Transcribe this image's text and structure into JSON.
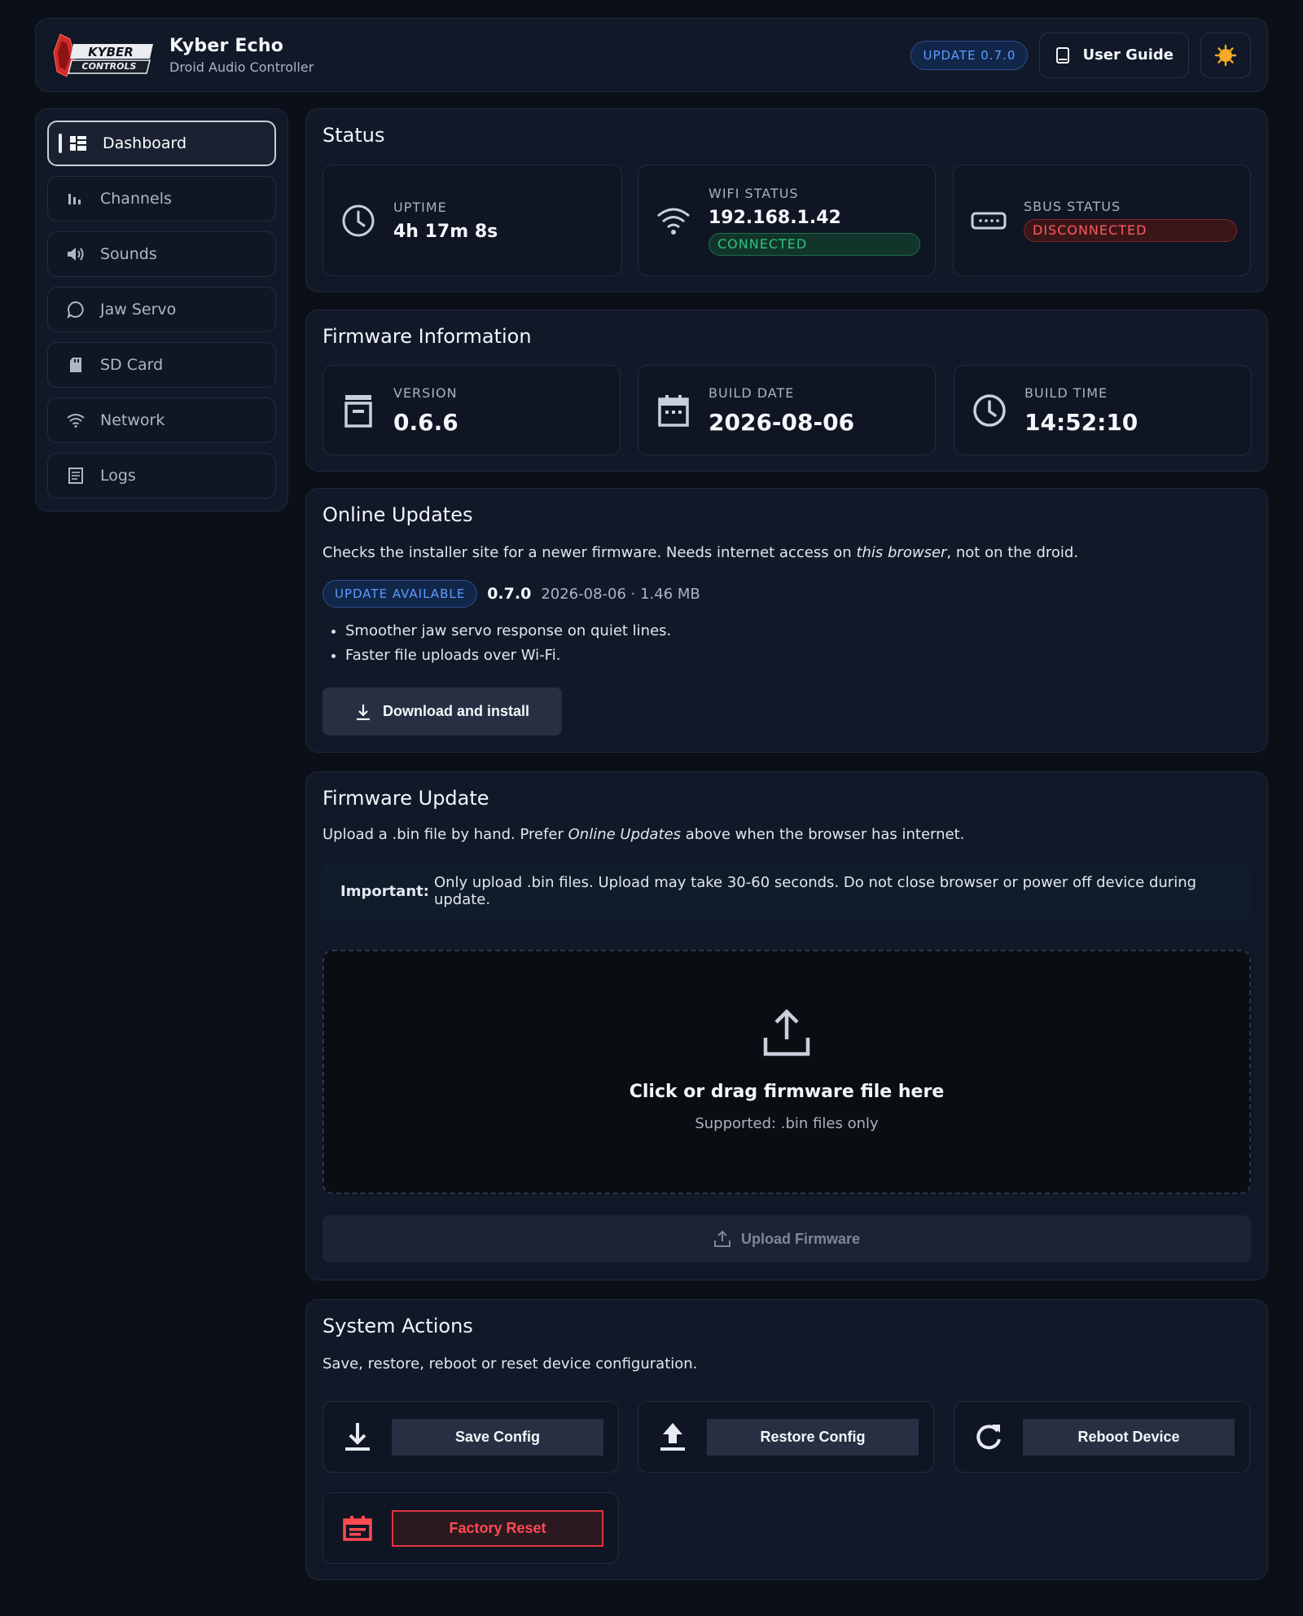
{
  "header": {
    "logo_text": "KYBER CONTROLS",
    "title": "Kyber Echo",
    "subtitle": "Droid Audio Controller",
    "update_badge": "UPDATE 0.7.0",
    "guide_label": "User Guide",
    "theme_icon": "sun-icon"
  },
  "sidebar": {
    "items": [
      {
        "label": "Dashboard",
        "icon": "dashboard-icon",
        "active": true
      },
      {
        "label": "Channels",
        "icon": "bars-icon"
      },
      {
        "label": "Sounds",
        "icon": "speaker-icon"
      },
      {
        "label": "Jaw Servo",
        "icon": "chat-bubble-icon"
      },
      {
        "label": "SD Card",
        "icon": "sd-card-icon"
      },
      {
        "label": "Network",
        "icon": "wifi-icon"
      },
      {
        "label": "Logs",
        "icon": "document-icon"
      }
    ]
  },
  "status": {
    "title": "Status",
    "uptime_label": "UPTIME",
    "uptime_value": "4h 17m 8s",
    "wifi_label": "WIFI STATUS",
    "wifi_value": "192.168.1.42",
    "wifi_state": "CONNECTED",
    "sbus_label": "SBUS STATUS",
    "sbus_state": "DISCONNECTED"
  },
  "firmware_info": {
    "title": "Firmware Information",
    "version_label": "VERSION",
    "version_value": "0.6.6",
    "date_label": "BUILD DATE",
    "date_value": "2026-08-06",
    "time_label": "BUILD TIME",
    "time_value": "14:52:10"
  },
  "online_updates": {
    "title": "Online Updates",
    "desc_before": "Checks the installer site for a newer firmware. Needs internet access on ",
    "desc_em": "this browser",
    "desc_after": ", not on the droid.",
    "badge": "UPDATE AVAILABLE",
    "version": "0.7.0",
    "meta": "2026-08-06 · 1.46 MB",
    "notes": [
      "Smoother jaw servo response on quiet lines.",
      "Faster file uploads over Wi-Fi."
    ],
    "button": "Download and install"
  },
  "firmware_update": {
    "title": "Firmware Update",
    "desc_before": "Upload a .bin file by hand. Prefer ",
    "desc_em": "Online Updates",
    "desc_after": " above when the browser has internet.",
    "important_label": "Important:",
    "important_text": "Only upload .bin files. Upload may take 30-60 seconds. Do not close browser or power off device during update.",
    "drop_title": "Click or drag firmware file here",
    "drop_sub": "Supported: .bin files only",
    "button": "Upload Firmware"
  },
  "system_actions": {
    "title": "System Actions",
    "desc": "Save, restore, reboot or reset device configuration.",
    "save": "Save Config",
    "restore": "Restore Config",
    "reboot": "Reboot Device",
    "reset": "Factory Reset"
  },
  "colors": {
    "background": "#0b0f17",
    "card": "#111827",
    "accent_blue": "#5b9cff",
    "success": "#2ec27e",
    "danger": "#ff4a52",
    "logo_red": "#d42a2a",
    "sun": "#f7a928"
  }
}
